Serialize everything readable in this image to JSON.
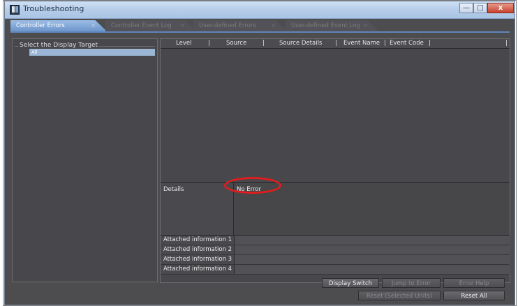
{
  "window": {
    "title": "Troubleshooting"
  },
  "title_buttons": {
    "minimize": "—",
    "maximize": "□",
    "close": "x"
  },
  "tabs": [
    {
      "label": "Controller Errors",
      "close": "×",
      "active": true
    },
    {
      "label": "Controller Event Log",
      "close": "×",
      "active": false
    },
    {
      "label": "User-defined Errors",
      "close": "×",
      "active": false
    },
    {
      "label": "User-defined Event Log",
      "close": "×",
      "active": false
    }
  ],
  "left_panel": {
    "heading": "Select the Display Target",
    "items": [
      {
        "label": "All",
        "selected": true
      }
    ]
  },
  "grid": {
    "columns": [
      "Level",
      "Source",
      "Source Details",
      "Event Name",
      "Event Code"
    ],
    "separator": "|",
    "rows": []
  },
  "details": {
    "label": "Details",
    "value": "No Error",
    "attached": [
      {
        "label": "Attached information 1",
        "value": ""
      },
      {
        "label": "Attached information 2",
        "value": ""
      },
      {
        "label": "Attached information 3",
        "value": ""
      },
      {
        "label": "Attached information 4",
        "value": ""
      }
    ]
  },
  "buttons": {
    "display_switch": "Display Switch",
    "jump_to_error": "Jump to Error",
    "error_help": "Error Help",
    "reset_selected": "Reset (Selected Units)",
    "reset_all": "Reset All"
  },
  "colors": {
    "highlight_ring": "#e21c1c",
    "active_tab": "#7ea3d4",
    "panel_bg": "#48484c"
  }
}
